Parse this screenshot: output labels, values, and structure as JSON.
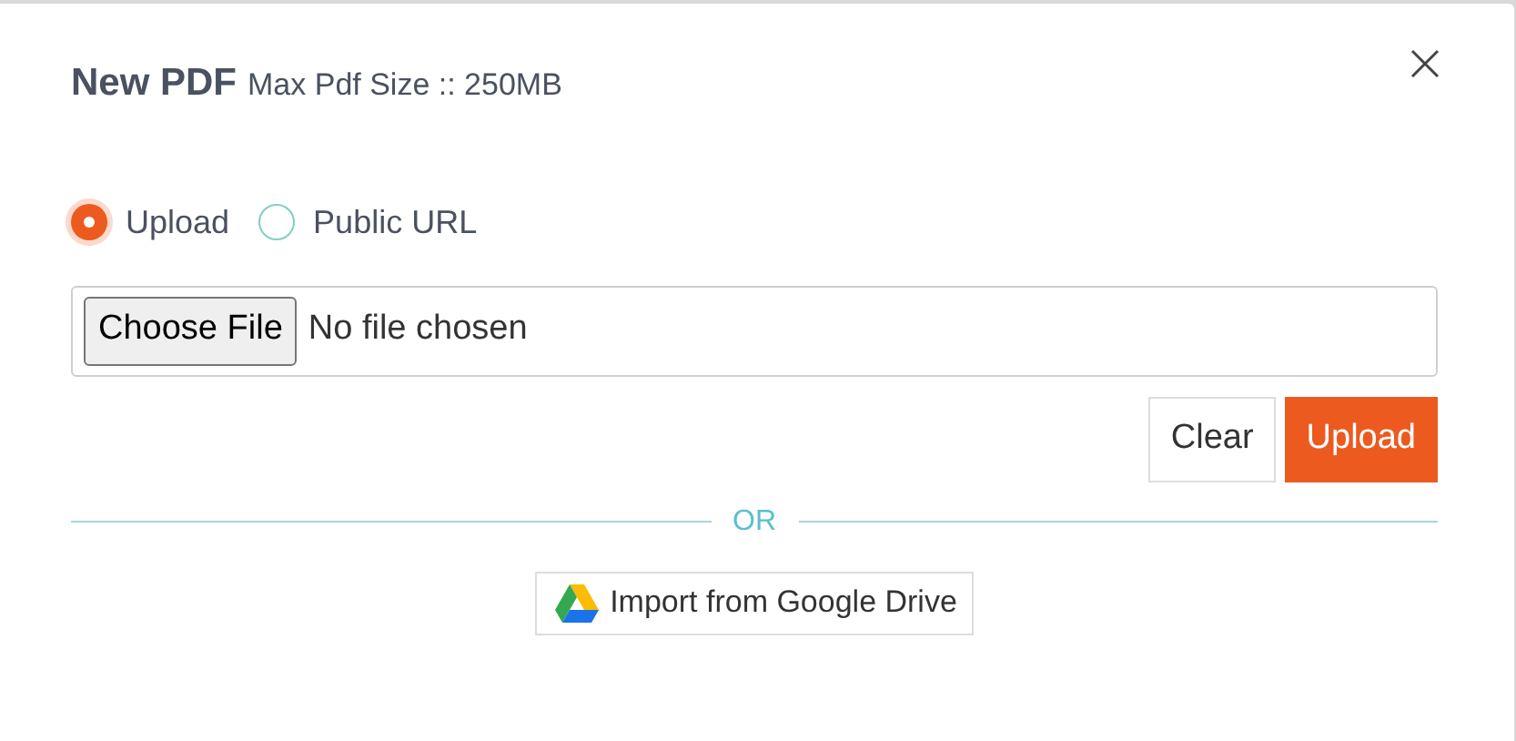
{
  "dialog": {
    "title": "New PDF",
    "subtitle": "Max Pdf Size :: 250MB"
  },
  "source_options": [
    {
      "label": "Upload",
      "selected": true
    },
    {
      "label": "Public URL",
      "selected": false
    }
  ],
  "file_field": {
    "button": "Choose File",
    "status": "No file chosen"
  },
  "buttons": [
    {
      "label": "Clear",
      "kind": "secondary"
    },
    {
      "label": "Upload",
      "kind": "primary"
    }
  ],
  "divider": "OR",
  "import_button": "Import from Google Drive"
}
